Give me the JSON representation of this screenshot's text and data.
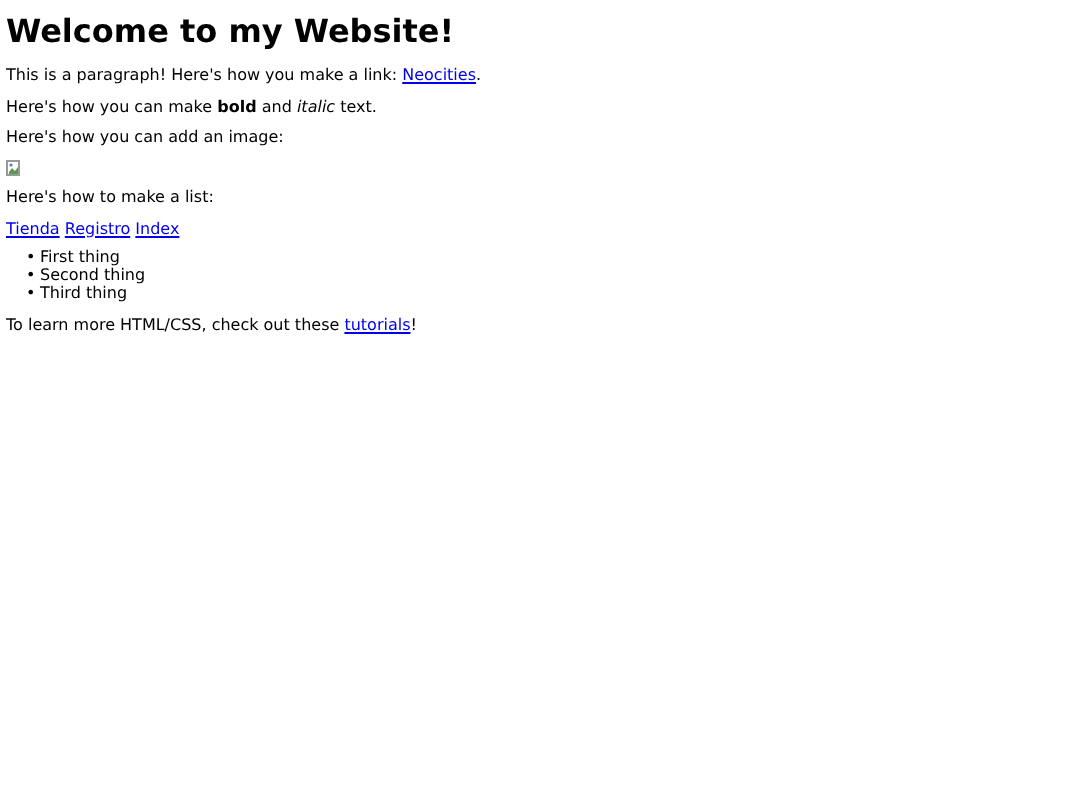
{
  "heading": "Welcome to my Website!",
  "link_paragraph": {
    "before": "This is a paragraph! Here's how you make a link: ",
    "link": "Neocities",
    "after": "."
  },
  "format_paragraph": "Here's how you can make **bold** and *italic* text.",
  "image_paragraph": "Here's how you can add an image:",
  "image": {
    "kind": "broken-image"
  },
  "list_paragraph": "Here's how to make a list:",
  "nav_links": [
    "Tienda",
    "Registro",
    "Index"
  ],
  "list_items": [
    {
      "marker": "•",
      "text": "First thing"
    },
    {
      "marker": "•",
      "text": "Second thing"
    },
    {
      "marker": "•",
      "text": "Third thing"
    }
  ],
  "footer_paragraph": {
    "before": "To learn more HTML/CSS, check out these ",
    "link": "tutorials",
    "after": "!"
  }
}
